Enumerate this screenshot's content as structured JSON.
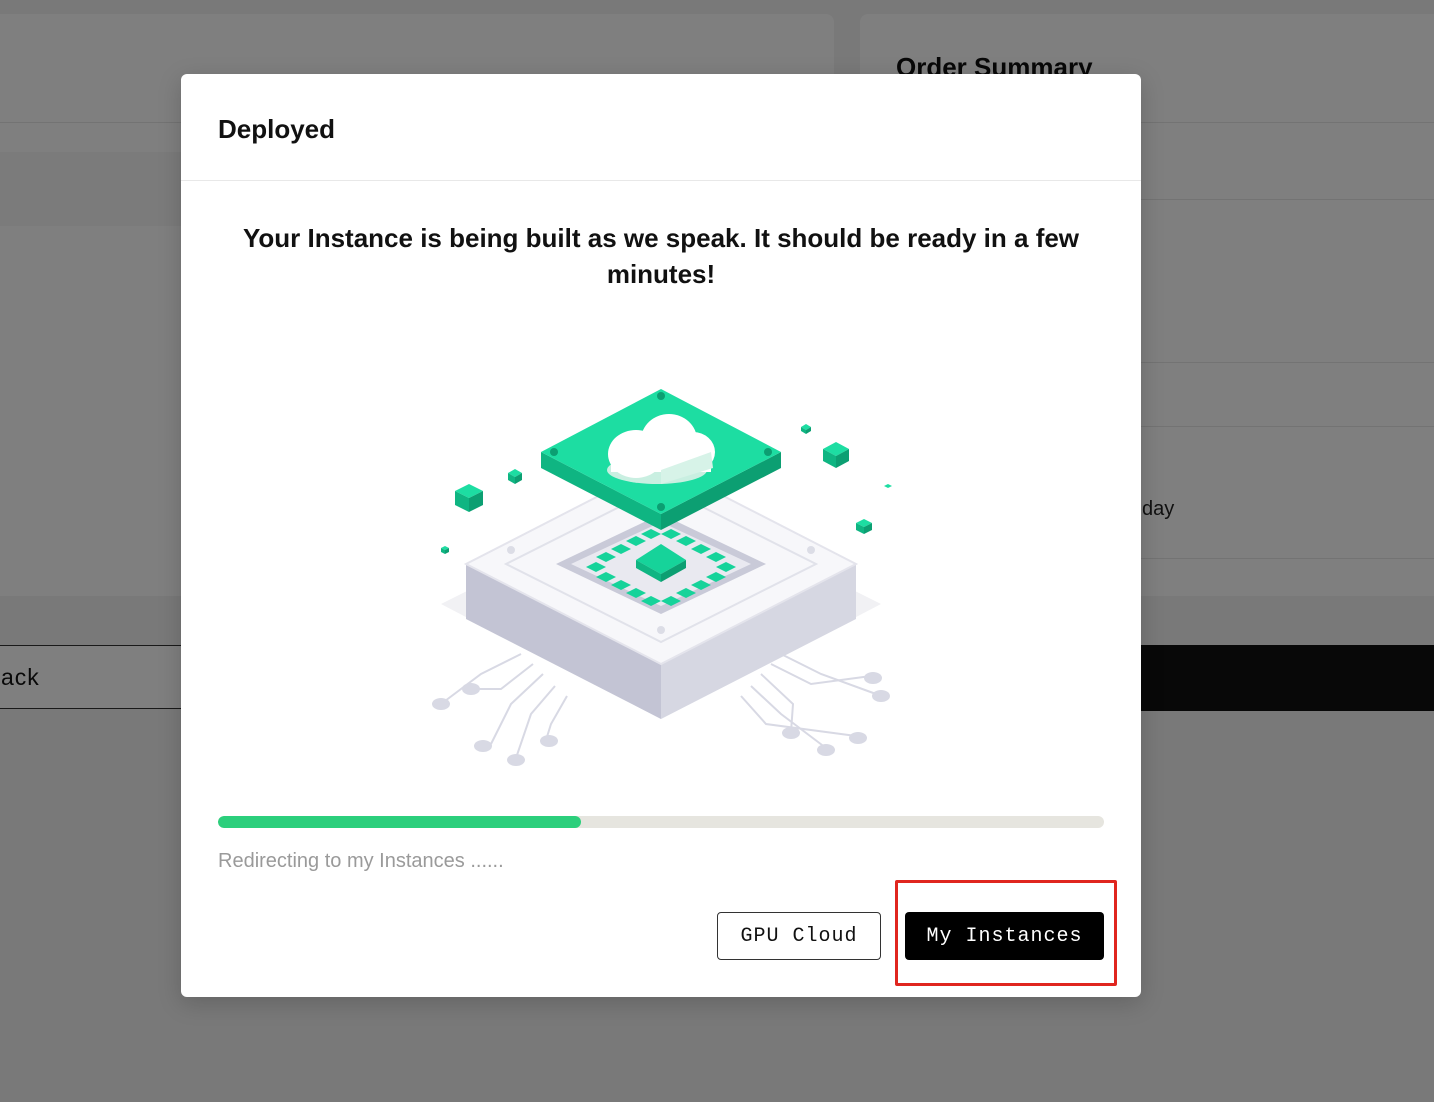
{
  "background": {
    "order_summary_title": "Order Summary",
    "day_text": "day",
    "back_button_label": "ack"
  },
  "modal": {
    "title": "Deployed",
    "message": "Your Instance is being built as we speak. It should be ready in a few minutes!",
    "illustration": "cloud-server-icon",
    "progress_percent": 41,
    "redirect_text": "Redirecting to my Instances ......",
    "buttons": {
      "gpu_cloud_label": "GPU Cloud",
      "my_instances_label": "My Instances"
    }
  },
  "colors": {
    "accent_green": "#2ccf7c",
    "illustration_green": "#16d39a",
    "highlight_red": "#e0261f",
    "progress_track": "#e6e5df"
  }
}
